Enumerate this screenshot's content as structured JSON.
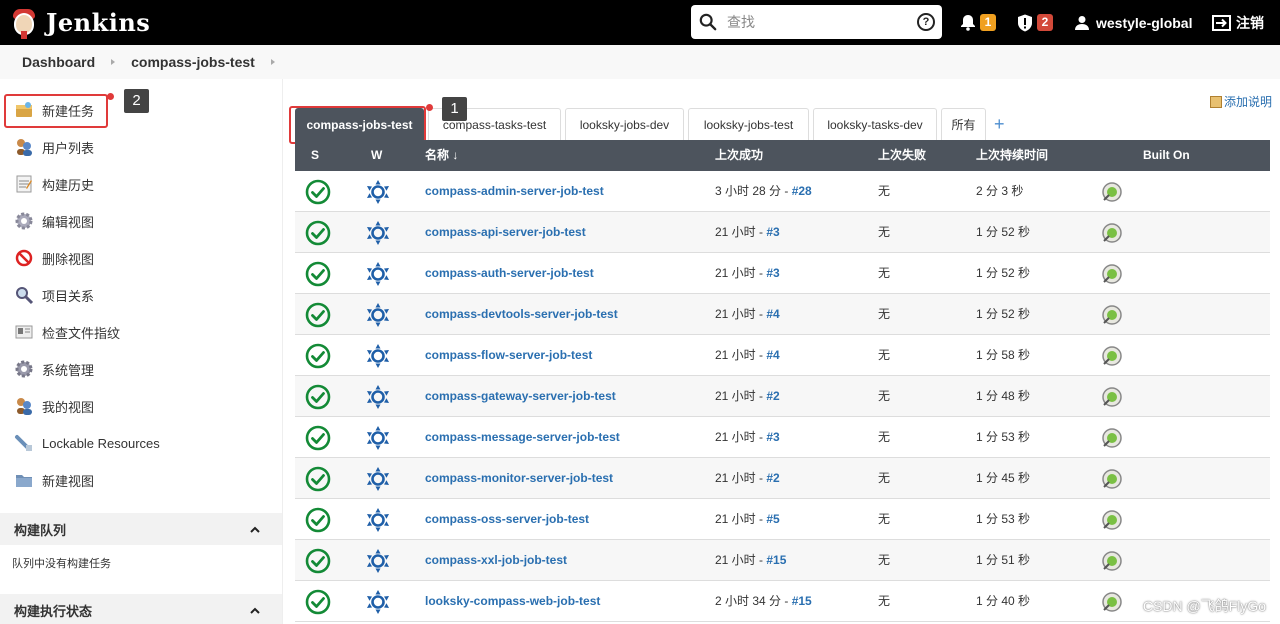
{
  "header": {
    "brand": "Jenkins",
    "search_placeholder": "查找",
    "help_glyph": "?",
    "notifications_count": "1",
    "security_count": "2",
    "user": "westyle-global",
    "logout": "注销"
  },
  "breadcrumb": [
    "Dashboard",
    "compass-jobs-test"
  ],
  "sidebar": {
    "items": [
      {
        "label": "新建任务",
        "icon": "new-job-icon"
      },
      {
        "label": "用户列表",
        "icon": "users-icon"
      },
      {
        "label": "构建历史",
        "icon": "notepad-icon"
      },
      {
        "label": "编辑视图",
        "icon": "gear-icon"
      },
      {
        "label": "删除视图",
        "icon": "no-entry-icon"
      },
      {
        "label": "项目关系",
        "icon": "magnifier-icon"
      },
      {
        "label": "检查文件指纹",
        "icon": "fingerprint-icon"
      },
      {
        "label": "系统管理",
        "icon": "gear-icon"
      },
      {
        "label": "我的视图",
        "icon": "users-icon"
      },
      {
        "label": "Lockable Resources",
        "icon": "lock-icon"
      },
      {
        "label": "新建视图",
        "icon": "folder-icon"
      }
    ],
    "queue_title": "构建队列",
    "queue_empty": "队列中没有构建任务",
    "executor_title": "构建执行状态"
  },
  "annotations": [
    "1",
    "2"
  ],
  "add_description": "添加说明",
  "tabs": [
    "compass-jobs-test",
    "compass-tasks-test",
    "looksky-jobs-dev",
    "looksky-jobs-test",
    "looksky-tasks-dev",
    "所有"
  ],
  "tab_add": "+",
  "table": {
    "headers": [
      "S",
      "W",
      "名称 ↓",
      "上次成功",
      "上次失败",
      "上次持续时间",
      "Built On"
    ],
    "rows": [
      {
        "name": "compass-admin-server-job-test",
        "success_time": "3 小时 28 分 - ",
        "build": "#28",
        "failure": "无",
        "duration": "2 分 3 秒"
      },
      {
        "name": "compass-api-server-job-test",
        "success_time": "21 小时 - ",
        "build": "#3",
        "failure": "无",
        "duration": "1 分 52 秒"
      },
      {
        "name": "compass-auth-server-job-test",
        "success_time": "21 小时 - ",
        "build": "#3",
        "failure": "无",
        "duration": "1 分 52 秒"
      },
      {
        "name": "compass-devtools-server-job-test",
        "success_time": "21 小时 - ",
        "build": "#4",
        "failure": "无",
        "duration": "1 分 52 秒"
      },
      {
        "name": "compass-flow-server-job-test",
        "success_time": "21 小时 - ",
        "build": "#4",
        "failure": "无",
        "duration": "1 分 58 秒"
      },
      {
        "name": "compass-gateway-server-job-test",
        "success_time": "21 小时 - ",
        "build": "#2",
        "failure": "无",
        "duration": "1 分 48 秒"
      },
      {
        "name": "compass-message-server-job-test",
        "success_time": "21 小时 - ",
        "build": "#3",
        "failure": "无",
        "duration": "1 分 53 秒"
      },
      {
        "name": "compass-monitor-server-job-test",
        "success_time": "21 小时 - ",
        "build": "#2",
        "failure": "无",
        "duration": "1 分 45 秒"
      },
      {
        "name": "compass-oss-server-job-test",
        "success_time": "21 小时 - ",
        "build": "#5",
        "failure": "无",
        "duration": "1 分 53 秒"
      },
      {
        "name": "compass-xxl-job-job-test",
        "success_time": "21 小时 - ",
        "build": "#15",
        "failure": "无",
        "duration": "1 分 51 秒"
      },
      {
        "name": "looksky-compass-web-job-test",
        "success_time": "2 小时 34 分 - ",
        "build": "#15",
        "failure": "无",
        "duration": "1 分 40 秒"
      }
    ]
  },
  "watermark": "CSDN @飞鸽FlyGo",
  "colors": {
    "header_bg": "#000000",
    "table_header_bg": "#4d545d",
    "link": "#2a6fb0",
    "success": "#138a36",
    "annotation": "#e03a3a"
  }
}
